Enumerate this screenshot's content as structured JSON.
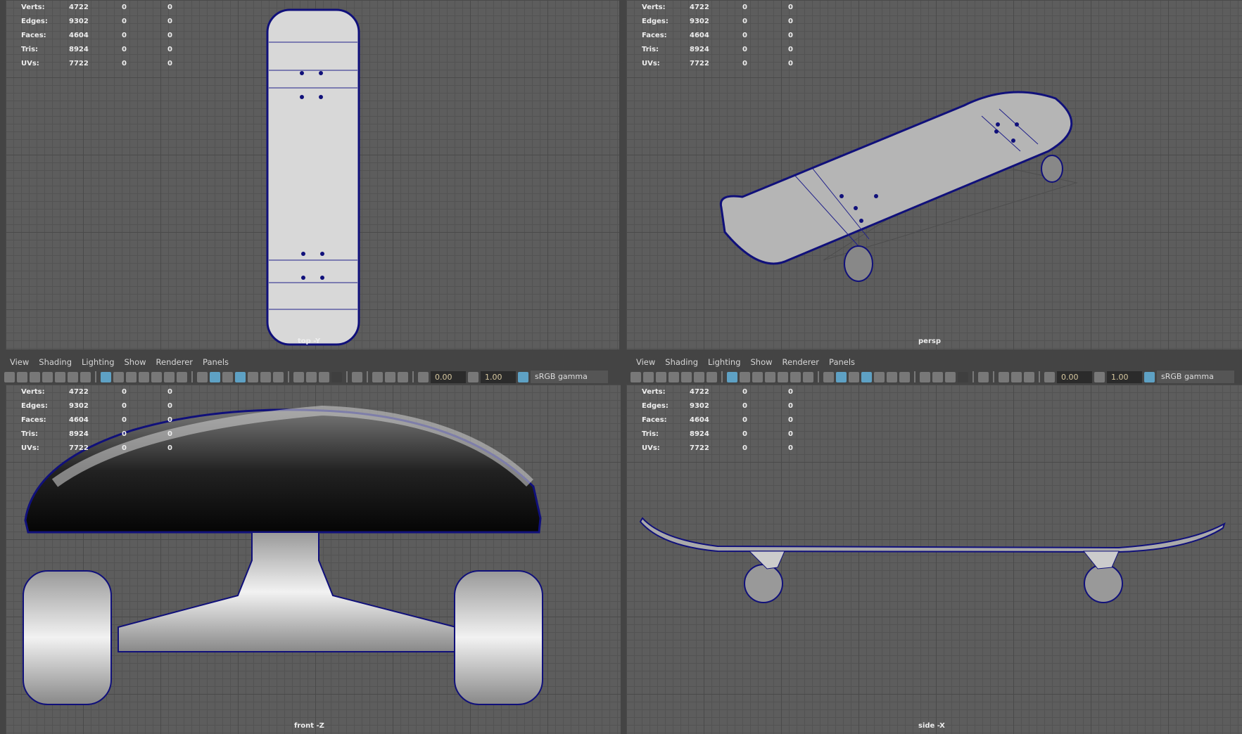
{
  "stats": {
    "labels": [
      "Verts:",
      "Edges:",
      "Faces:",
      "Tris:",
      "UVs:"
    ],
    "values": [
      "4722",
      "9302",
      "4604",
      "8924",
      "7722"
    ],
    "col2": [
      "0",
      "0",
      "0",
      "0",
      "0"
    ],
    "col3": [
      "0",
      "0",
      "0",
      "0",
      "0"
    ]
  },
  "menu": [
    "View",
    "Shading",
    "Lighting",
    "Show",
    "Renderer",
    "Panels"
  ],
  "toolbar": {
    "exposure": "0.00",
    "gamma": "1.00",
    "colorspace": "sRGB gamma"
  },
  "panes": [
    {
      "camera": "top -Y"
    },
    {
      "camera": "persp"
    },
    {
      "camera": "front -Z"
    },
    {
      "camera": "side -X"
    }
  ]
}
